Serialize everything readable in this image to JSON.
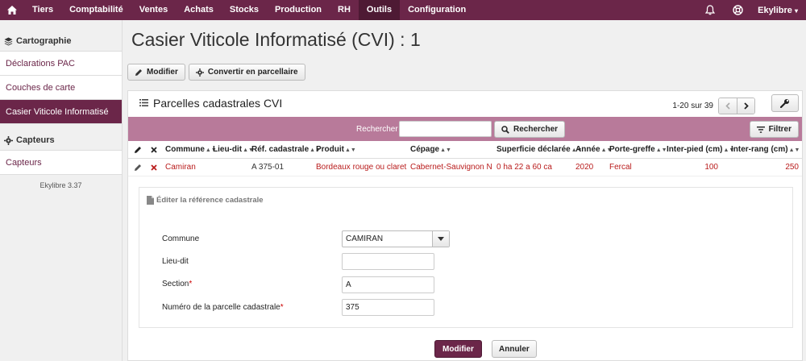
{
  "nav": {
    "items": [
      {
        "label": "Tiers",
        "active": false
      },
      {
        "label": "Comptabilité",
        "active": false
      },
      {
        "label": "Ventes",
        "active": false
      },
      {
        "label": "Achats",
        "active": false
      },
      {
        "label": "Stocks",
        "active": false
      },
      {
        "label": "Production",
        "active": false
      },
      {
        "label": "RH",
        "active": false
      },
      {
        "label": "Outils",
        "active": true
      },
      {
        "label": "Configuration",
        "active": false
      }
    ],
    "user": "Ekylibre",
    "accent": "#6b2649"
  },
  "sidebar": {
    "sections": [
      {
        "title": "Cartographie",
        "icon": "layers-icon",
        "items": [
          {
            "label": "Déclarations PAC",
            "active": false
          },
          {
            "label": "Couches de carte",
            "active": false
          },
          {
            "label": "Casier Viticole Informatisé",
            "active": true
          }
        ]
      },
      {
        "title": "Capteurs",
        "icon": "gear-icon",
        "items": [
          {
            "label": "Capteurs",
            "active": false
          }
        ]
      }
    ],
    "version": "Ekylibre 3.37"
  },
  "page": {
    "title": "Casier Viticole Informatisé (CVI) : 1",
    "toolbar": {
      "edit_label": "Modifier",
      "convert_label": "Convertir en parcellaire"
    }
  },
  "panel": {
    "title": "Parcelles cadastrales CVI",
    "pager_text": "1-20 sur 39",
    "search_label": "Rechercher",
    "search_value": "",
    "search_button": "Rechercher",
    "filter_button": "Filtrer"
  },
  "table": {
    "columns": [
      "Commune",
      "Lieu-dit",
      "Réf. cadastrale",
      "Produit",
      "Cépage",
      "Superficie déclarée",
      "Année",
      "Porte-greffe",
      "Inter-pied (cm)",
      "Inter-rang (cm)"
    ],
    "rows": [
      [
        "Camiran",
        "",
        "A 375-01",
        "Bordeaux rouge ou claret",
        "Cabernet-Sauvignon N",
        "0 ha 22 a 60 ca",
        "2020",
        "Fercal",
        "100",
        "250"
      ]
    ]
  },
  "form": {
    "legend": "Éditer la référence cadastrale",
    "fields": {
      "commune": {
        "label": "Commune",
        "value": "CAMIRAN"
      },
      "lieu_dit": {
        "label": "Lieu-dit",
        "value": ""
      },
      "section": {
        "label": "Section",
        "required_mark": "*",
        "value": "A"
      },
      "parcel_number": {
        "label": "Numéro de la parcelle cadastrale",
        "required_mark": "*",
        "value": "375"
      }
    },
    "submit_label": "Modifier",
    "cancel_label": "Annuler"
  }
}
